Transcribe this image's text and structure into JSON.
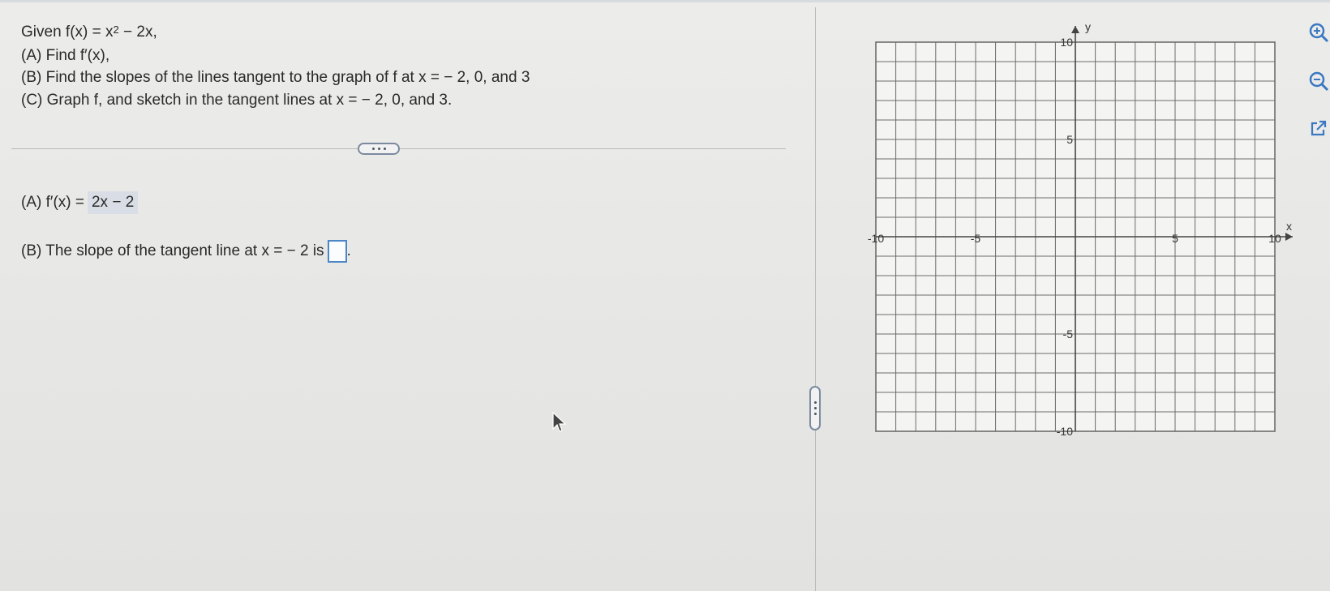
{
  "question": {
    "given_prefix": "Given f(x) = x",
    "given_exp": "2",
    "given_suffix": " − 2x,",
    "part_a": "(A)  Find f′(x),",
    "part_b": "(B)  Find the slopes of the lines tangent to the graph of f at x = − 2, 0, and 3",
    "part_c": "(C)  Graph f, and sketch in the tangent lines at x = − 2, 0, and 3."
  },
  "answer_a": {
    "label": "(A)  f′(x) =",
    "value": "2x − 2"
  },
  "answer_b": {
    "text": "(B)  The slope of the tangent line at x = − 2 is",
    "trailing": ".",
    "value": ""
  },
  "graph": {
    "x_axis_label": "x",
    "y_axis_label": "y",
    "x_ticks": [
      "-10",
      "-5",
      "5",
      "10"
    ],
    "y_ticks": [
      "10",
      "5",
      "-5",
      "-10"
    ],
    "x_range": [
      -10,
      10
    ],
    "y_range": [
      -10,
      10
    ],
    "grid": true
  },
  "tools": [
    "zoom-in-icon",
    "zoom-out-icon",
    "external-link-icon"
  ],
  "colors": {
    "input_border": "#4b86c8",
    "answer_bg": "#d9dee6",
    "tool_blue": "#3a78c2"
  }
}
